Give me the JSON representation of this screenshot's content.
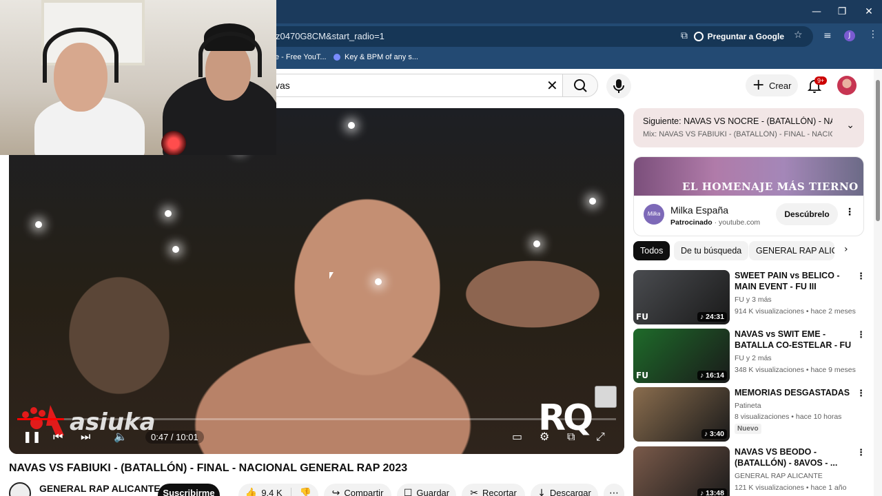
{
  "browser": {
    "url_fragment": "z0470G8CM&start_radio=1",
    "ask_google": "Preguntar a Google",
    "profile_initial": "J",
    "bookmarks": [
      {
        "label": "e - Free YouT..."
      },
      {
        "label": "Key & BPM of any s..."
      }
    ],
    "window_controls": {
      "minimize": "—",
      "maximize": "❐",
      "close": "✕"
    }
  },
  "youtube_header": {
    "search_value": "vas",
    "create_label": "Crear",
    "notifications_count": "9+"
  },
  "player": {
    "current_time": "0:47",
    "duration": "10:01",
    "time_display": "0:47 / 10:01",
    "progress_fraction": 0.078,
    "watermark_left": "asiuka",
    "watermark_right": "RQ"
  },
  "video": {
    "title": "NAVAS VS FABIUKI - (BATALLÓN) - FINAL - NACIONAL GENERAL RAP 2023",
    "channel": "GENERAL RAP ALICANTE",
    "subscribe_label": "Suscribirme",
    "actions": {
      "likes": "9,4 K",
      "share": "Compartir",
      "save": "Guardar",
      "clip": "Recortar",
      "download": "Descargar"
    }
  },
  "sidebar": {
    "up_next": {
      "line1": "Siguiente: NAVAS VS NOCRE - (BATALLÓN) - NACI...",
      "line2": "Mix: NAVAS VS FABIUKI - (BATALLÓN) - FINAL - NACIONAL ..."
    },
    "ad": {
      "banner_text": "EL HOMENAJE MÁS TIERNO",
      "advertiser": "Milka España",
      "sponsored_label": "Patrocinado",
      "domain": "youtube.com",
      "cta": "Descúbrelo",
      "logo_text": "Milka"
    },
    "chips": [
      {
        "label": "Todos"
      },
      {
        "label": "De tu búsqueda"
      },
      {
        "label": "GENERAL RAP ALICA"
      }
    ],
    "recommendations": [
      {
        "title": "SWEET PAIN vs BELICO - MAIN EVENT - FU III (Barcelona)",
        "channel": "FU y 3 más",
        "stats": "914 K visualizaciones • hace 2 meses",
        "duration": "♪ 24:31",
        "thumb_color": "#4a4c50"
      },
      {
        "title": "NAVAS vs SWIT EME - BATALLA CO-ESTELAR - FU I (Alicante)",
        "channel": "FU y 2 más",
        "stats": "348 K visualizaciones • hace 9 meses",
        "duration": "♪ 16:14",
        "thumb_color": "#1e6b2a"
      },
      {
        "title": "MEMORIAS DESGASTADAS",
        "channel": "Patineta",
        "stats": "8 visualizaciones • hace 10 horas",
        "badge": "Nuevo",
        "duration": "♪ 3:40",
        "thumb_color": "#8a6d4e"
      },
      {
        "title": "NAVAS VS BEODO - (BATALLÓN) - 8AVOS - ...",
        "channel": "GENERAL RAP ALICANTE",
        "stats": "121 K visualizaciones • hace 1 año",
        "duration": "♪ 13:48",
        "thumb_color": "#7a5a4a"
      }
    ]
  }
}
